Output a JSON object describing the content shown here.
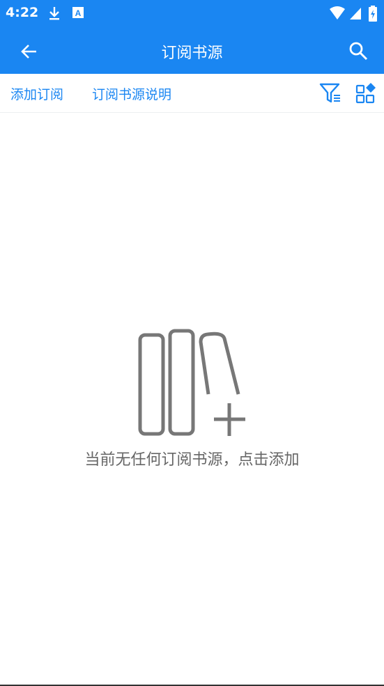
{
  "status_bar": {
    "time": "4:22",
    "left_icons": [
      "download-icon",
      "font-a-icon"
    ],
    "right_icons": [
      "wifi-icon",
      "signal-icon",
      "battery-charging-icon"
    ]
  },
  "app_bar": {
    "title": "订阅书源",
    "back_icon": "arrow-left-icon",
    "search_icon": "search-icon",
    "background": "#1a86f2"
  },
  "toolbar": {
    "add_subscription": "添加订阅",
    "source_help": "订阅书源说明",
    "filter_icon": "filter-icon",
    "layout_icon": "grid-layout-icon",
    "accent": "#1a86f2"
  },
  "empty_state": {
    "icon": "books-add-icon",
    "message": "当前无任何订阅书源，点击添加"
  }
}
